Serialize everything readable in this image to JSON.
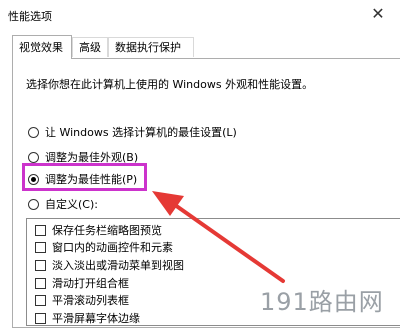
{
  "window": {
    "title": "性能选项"
  },
  "tabs": [
    {
      "label": "视觉效果",
      "active": true
    },
    {
      "label": "高级",
      "active": false
    },
    {
      "label": "数据执行保护",
      "active": false
    }
  ],
  "description": "选择你想在此计算机上使用的 Windows 外观和性能设置。",
  "options": [
    {
      "label": "让 Windows 选择计算机的最佳设置(L)",
      "checked": false
    },
    {
      "label": "调整为最佳外观(B)",
      "checked": false
    },
    {
      "label": "调整为最佳性能(P)",
      "checked": true
    },
    {
      "label": "自定义(C):",
      "checked": false
    }
  ],
  "effects": [
    {
      "label": "保存任务栏缩略图预览",
      "checked": false
    },
    {
      "label": "窗口内的动画控件和元素",
      "checked": false
    },
    {
      "label": "淡入淡出或滑动菜单到视图",
      "checked": false
    },
    {
      "label": "滑动打开组合框",
      "checked": false
    },
    {
      "label": "平滑滚动列表框",
      "checked": false
    },
    {
      "label": "平滑屏幕字体边缘",
      "checked": false
    }
  ],
  "annotation": {
    "highlight_color": "#cc33cc",
    "arrow_color": "#e53935"
  },
  "watermark": "191路由网"
}
